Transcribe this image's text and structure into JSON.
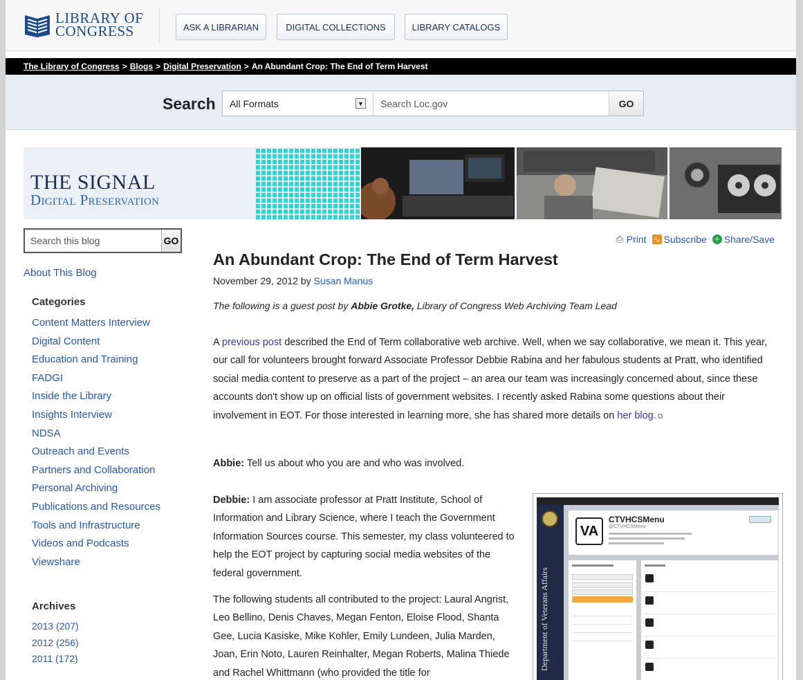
{
  "header": {
    "logo_line1": "LIBRARY OF",
    "logo_line2": "CONGRESS",
    "buttons": [
      "ASK A LIBRARIAN",
      "DIGITAL COLLECTIONS",
      "LIBRARY CATALOGS"
    ]
  },
  "breadcrumb": {
    "items": [
      "The Library of Congress",
      "Blogs",
      "Digital Preservation"
    ],
    "current": "An Abundant Crop: The End of Term Harvest",
    "separator": ">"
  },
  "search": {
    "label": "Search",
    "format_selected": "All Formats",
    "placeholder": "Search Loc.gov",
    "go_label": "GO"
  },
  "banner": {
    "title": "THE SIGNAL",
    "subtitle": "Digital Preservation"
  },
  "sidebar": {
    "blog_search_placeholder": "Search this blog",
    "blog_search_go": "GO",
    "about_link": "About This Blog",
    "categories_heading": "Categories",
    "categories": [
      "Content Matters Interview",
      "Digital Content",
      "Education and Training",
      "FADGI",
      "Inside the Library",
      "Insights Interview",
      "NDSA",
      "Outreach and Events",
      "Partners and Collaboration",
      "Personal Archiving",
      "Publications and Resources",
      "Tools and Infrastructure",
      "Videos and Podcasts",
      "Viewshare"
    ],
    "archives_heading": "Archives",
    "archives": [
      "2013 (207)",
      "2012 (256)",
      "2011 (172)"
    ]
  },
  "tools": {
    "print": "Print",
    "subscribe": "Subscribe",
    "share": "Share/Save"
  },
  "post": {
    "title": "An Abundant Crop: The End of Term Harvest",
    "date_by": "November 29, 2012 by",
    "author": "Susan Manus",
    "intro_prefix": "The following is a guest post by",
    "intro_name": "Abbie Grotke,",
    "intro_suffix": "Library of Congress Web Archiving Team Lead",
    "p1_a": "A",
    "p1_link": "previous post",
    "p1_b": "described the End of Term collaborative web archive. Well, when we say collaborative, we mean it. This year, our call for volunteers brought forward Associate Professor Debbie Rabina and her fabulous students at Pratt, who identified social media content to preserve as a part of the project – an area our team was increasingly concerned about, since these accounts don't show up on official lists of government websites.  I recently asked Rabina some questions about their involvement in EOT. For those interested in learning more, she has shared more details on",
    "p1_link2": "her blog.",
    "p2_speaker": "Abbie:",
    "p2_text": "Tell us about who you are and who was involved.",
    "p3_speaker": "Debbie:",
    "p3_text": "I am associate professor at Pratt Institute, School of Information and Library Science, where I teach the Government Information Sources course.  This semester, my class volunteered to help the EOT project by capturing social media websites of the federal government.",
    "p4_text": "The following students all contributed to the project:  Laural Angrist, Leo Bellino, Denis Chaves, Megan Fenton, Eloise Flood, Shanta Gee, Lucia Kasiske, Mike Kohler, Emily Lundeen, Julia Marden, Joan, Erin Noto, Lauren Reinhalter, Megan Roberts, Malina Thiede and Rachel Whittmann (who provided the title for"
  },
  "figure": {
    "account_name": "CTVHCSMenu",
    "handle": "@CTVHCSMenu",
    "side_text": "Department of Veterans Affairs",
    "avatar_letters": "VA"
  },
  "colors": {
    "link": "#2659a8",
    "breadcrumb_bg": "#000000",
    "search_bg": "#e6edf5",
    "logo_blue": "#1a4a8a"
  }
}
